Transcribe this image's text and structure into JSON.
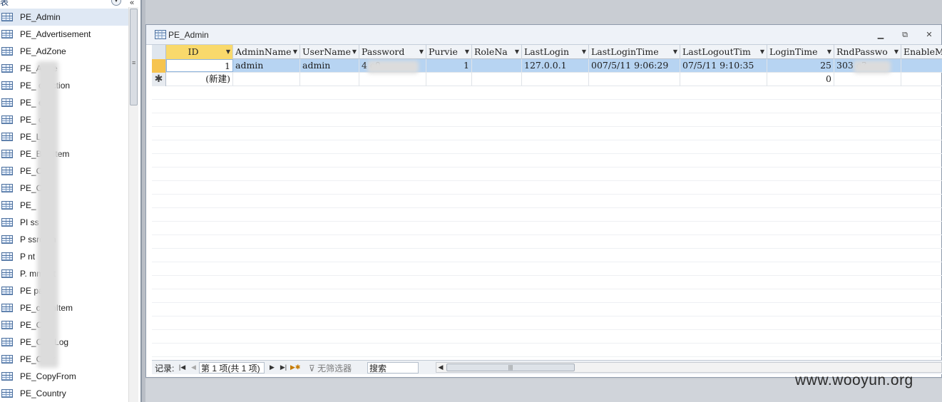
{
  "nav": {
    "header_label": "表",
    "items": [
      {
        "label": "PE_Admin",
        "selected": true
      },
      {
        "label": "PE_Advertisement"
      },
      {
        "label": "PE_AdZone"
      },
      {
        "label": "PE_A      nce"
      },
      {
        "label": "PE_        ollection"
      },
      {
        "label": "PE_       e"
      },
      {
        "label": "PE_       or"
      },
      {
        "label": "PE_L"
      },
      {
        "label": "PE_Ba        llItem"
      },
      {
        "label": "PE_C"
      },
      {
        "label": "PE_C       el"
      },
      {
        "label": "PE_"
      },
      {
        "label": "PI        ss"
      },
      {
        "label": "P         ssroom"
      },
      {
        "label": "P          nt"
      },
      {
        "label": "P.          mment"
      },
      {
        "label": "PE         pany"
      },
      {
        "label": "PE_c       lainItem"
      },
      {
        "label": "PE_Co"
      },
      {
        "label": "PE_Co          eLog"
      },
      {
        "label": "PE_Cor         r"
      },
      {
        "label": "PE_CopyFrom"
      },
      {
        "label": "PE_Country"
      }
    ]
  },
  "doc": {
    "title": "PE_Admin"
  },
  "grid": {
    "columns": [
      {
        "label": "ID",
        "active": true
      },
      {
        "label": "AdminName"
      },
      {
        "label": "UserName"
      },
      {
        "label": "Password"
      },
      {
        "label": "Purvie"
      },
      {
        "label": "RoleNa"
      },
      {
        "label": "LastLogin"
      },
      {
        "label": "LastLoginTime"
      },
      {
        "label": "LastLogoutTim"
      },
      {
        "label": "LoginTime"
      },
      {
        "label": "RndPasswo"
      },
      {
        "label": "EnableM"
      }
    ],
    "rows": [
      [
        "1",
        "admin",
        "admin",
        "4          c0",
        "1",
        "",
        "127.0.0.1",
        "007/5/11 9:06:29",
        "07/5/11 9:10:35",
        "25",
        "303        c3",
        ""
      ],
      [
        "(新建)",
        "",
        "",
        "",
        "",
        "",
        "",
        "",
        "",
        "0",
        "",
        ""
      ]
    ]
  },
  "record_nav": {
    "label": "记录:",
    "position": "第 1 项(共 1 项)",
    "filter": "无筛选器",
    "search": "搜索"
  },
  "watermark": "www.wooyun.org"
}
